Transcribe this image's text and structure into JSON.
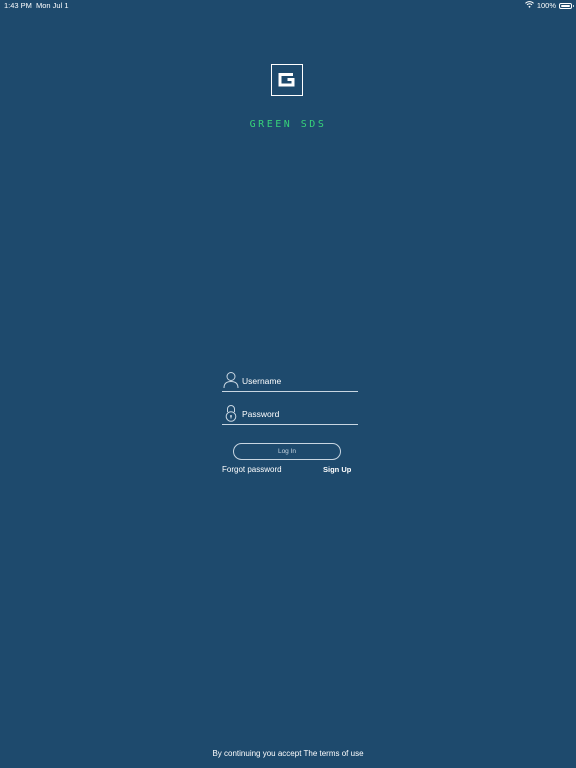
{
  "status_bar": {
    "time": "1:43 PM",
    "date": "Mon Jul 1",
    "battery": "100%",
    "battery_level": 1.0,
    "icons": [
      "wifi-icon",
      "battery-icon"
    ]
  },
  "brand": {
    "name": "GREEN SDS",
    "accent_color": "#37d27a",
    "logo_icon": "g-logo-icon"
  },
  "form": {
    "username_placeholder": "Username",
    "password_placeholder": "Password",
    "username_icon": "user-icon",
    "password_icon": "lock-icon",
    "login_label": "Log In",
    "forgot_label": "Forgot password",
    "signup_label": "Sign Up"
  },
  "footer": {
    "terms_text": "By continuing you accept The terms of use"
  },
  "colors": {
    "background": "#1e4a6d",
    "text": "#ffffff"
  }
}
